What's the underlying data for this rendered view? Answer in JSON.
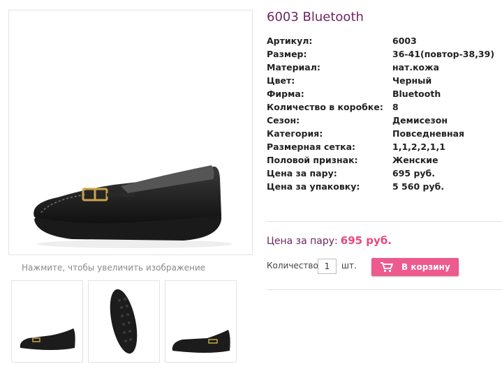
{
  "product": {
    "title": "6003 Bluetooth",
    "zoom_hint": "Нажмите, чтобы увеличить изображение",
    "specs": [
      {
        "label": "Артикул:",
        "value": "6003"
      },
      {
        "label": "Размер:",
        "value": "36-41(повтор-38,39)"
      },
      {
        "label": "Материал:",
        "value": "нат.кожа"
      },
      {
        "label": "Цвет:",
        "value": "Черный"
      },
      {
        "label": "Фирма:",
        "value": "Bluetooth"
      },
      {
        "label": "Количество в коробке:",
        "value": "8"
      },
      {
        "label": "Сезон:",
        "value": "Демисезон"
      },
      {
        "label": "Категория:",
        "value": "Повседневная"
      },
      {
        "label": "Размерная сетка:",
        "value": "1,1,2,2,1,1"
      },
      {
        "label": "Половой признак:",
        "value": "Женские"
      },
      {
        "label": "Цена за пару:",
        "value": "695 руб."
      },
      {
        "label": "Цена за упаковку:",
        "value": "5 560 руб."
      }
    ]
  },
  "purchase": {
    "price_label": "Цена за пару:",
    "price_value": "695 руб.",
    "quantity_label": "Количество",
    "quantity_value": "1",
    "quantity_unit": "шт.",
    "cart_button_label": "В корзину"
  },
  "colors": {
    "title": "#6d2560",
    "price": "#e9487f",
    "button": "#ec5a8e"
  },
  "icons": {
    "cart": "shopping-cart-icon"
  }
}
